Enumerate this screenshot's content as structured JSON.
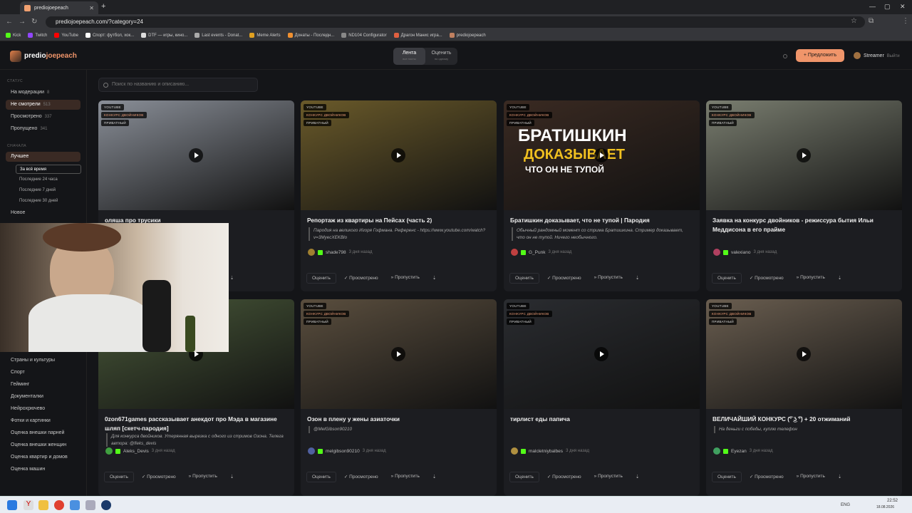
{
  "browser": {
    "tab_title": "prediojoepeach",
    "url": "prediojoepeach.com/?category=24",
    "bookmarks": [
      "Kick",
      "Twitch",
      "YouTube",
      "Спорт: футбол, хок...",
      "DTF — игры, кино...",
      "Last events - Donat...",
      "Meme Alerts",
      "Донаты - Последн...",
      "ND104 Configurator",
      "Драгон Манис игра...",
      "prediojoepeach"
    ]
  },
  "header": {
    "brand_a": "predio",
    "brand_b": "joepeach",
    "seg_feed": "Лента",
    "seg_feed_sub": "все посты",
    "seg_rate": "Оценить",
    "seg_rate_sub": "по одному",
    "propose": "+ Предложить",
    "user": "Streamer",
    "logout": "Выйти"
  },
  "sidebar": {
    "status_title": "СТАТУС",
    "status": [
      {
        "label": "На модерации",
        "count": "8"
      },
      {
        "label": "Не смотрели",
        "count": "513"
      },
      {
        "label": "Просмотрено",
        "count": "337"
      },
      {
        "label": "Пропущено",
        "count": "341"
      }
    ],
    "sort_title": "СНАЧАЛА",
    "best": "Лучшее",
    "periods": [
      "За всё время",
      "Последние 24 часа",
      "Последние 7 дней",
      "Последние 30 дней"
    ],
    "new": "Новое",
    "categories": [
      "Страны и культуры",
      "Спорт",
      "Гейминг",
      "Документалки",
      "Нейрохрючево",
      "Фотки и картинки",
      "Оценка внешки парней",
      "Оценка внешки женщин",
      "Оценка квартир и домов",
      "Оценка машин"
    ]
  },
  "search": {
    "placeholder": "Поиск по названию и описанию..."
  },
  "labels": {
    "yt": "YOUTUBE",
    "contest": "КОНКУРС ДВОЙНИКОВ",
    "private": "ПРИВАТНЫЙ",
    "rate": "Оценить",
    "watched": "✓ Просмотрено",
    "skip": "» Пропустить",
    "pin": "⇣"
  },
  "cards": [
    {
      "title": "оляша про трусики",
      "desc": "",
      "author": "",
      "time": "",
      "thumb": "#8a8f98"
    },
    {
      "title": "Репортаж из квартиры на Пейсах (часть 2)",
      "desc": "Пародия на великого Игоря Гофмана. Референс - https://www.youtube.com/watch?v=3MyecXEKBlo",
      "author": "shade798",
      "time": "3 дня назад",
      "thumb": "#6a5a2a",
      "av": "#a08030"
    },
    {
      "title": "Братишкин доказывает, что не тупой | Пародия",
      "desc": "Обычный рандомный момент со стрима Братишкина. Стример доказывает, что он не тупой. Ничего необычного.",
      "author": "G_Punk",
      "time": "3 дня назад",
      "thumb": "#3a2a22",
      "av": "#c04040"
    },
    {
      "title": "Заявка на конкурс двойников - режиссура бытия Ильи Меддисона в его прайме",
      "desc": "",
      "author": "valexiano",
      "time": "3 дня назад",
      "thumb": "#7a7e70",
      "av": "#b04060"
    },
    {
      "title": "0zon671games рассказывает анекдот про Мэда в магазине шляп [скетч-пародия]",
      "desc": "Для конкурса двойников. Утерянная вырезка с одного из стримов Озона. Телега автора: @fleks_devis",
      "author": "Aleks_Devis",
      "time": "3 дня назад",
      "thumb": "#4a5a3a",
      "av": "#40a040"
    },
    {
      "title": "Озон в плену у жены азиаточки",
      "desc": "@MelGibson90210",
      "author": "melgibson90210",
      "time": "3 дня назад",
      "thumb": "#5a4e3e",
      "av": "#5060a0"
    },
    {
      "title": "тирлист еды папича",
      "desc": "",
      "author": "malcletniybalbes",
      "time": "3 дня назад",
      "thumb": "#2a2c30",
      "av": "#b09040"
    },
    {
      "title": "ВЕЛИЧАЙШИЙ КОНКУРС (͡° ͜ʖ ͡°) + 20 отжиманий",
      "desc": "На деньги с победы, куплю телефон",
      "author": "Eyezan",
      "time": "3 дня назад",
      "thumb": "#6a5e50",
      "av": "#40a060"
    }
  ],
  "thumb_text": {
    "line1": "БРАТИШКИН",
    "line2": "ДОКАЗЫВАЕТ",
    "line3": "ЧТО ОН НЕ ТУПОЙ"
  },
  "taskbar": {
    "lang": "ENG",
    "time": "22:52",
    "date": "18.08.2026"
  }
}
